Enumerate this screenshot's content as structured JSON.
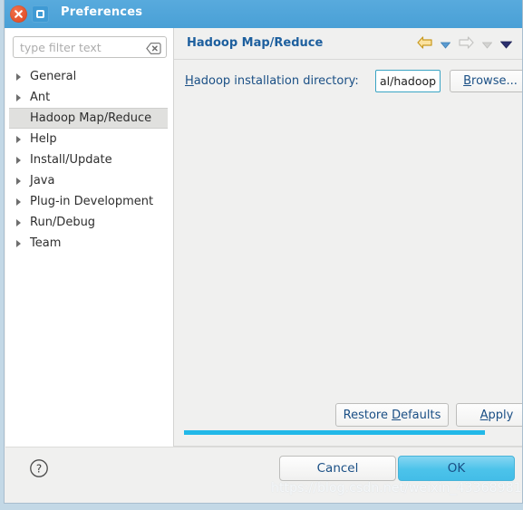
{
  "window": {
    "title": "Preferences",
    "close_icon": "close-icon",
    "maximize_icon": "maximize-icon",
    "titlebar_color": "#49a0d6"
  },
  "sidebar": {
    "filter": {
      "placeholder": "type filter text",
      "value": "",
      "clear_icon": "clear-icon"
    },
    "items": [
      {
        "label": "General",
        "expandable": true,
        "selected": false
      },
      {
        "label": "Ant",
        "expandable": true,
        "selected": false
      },
      {
        "label": "Hadoop Map/Reduce",
        "expandable": false,
        "selected": true
      },
      {
        "label": "Help",
        "expandable": true,
        "selected": false
      },
      {
        "label": "Install/Update",
        "expandable": true,
        "selected": false
      },
      {
        "label": "Java",
        "expandable": true,
        "selected": false
      },
      {
        "label": "Plug-in Development",
        "expandable": true,
        "selected": false
      },
      {
        "label": "Run/Debug",
        "expandable": true,
        "selected": false
      },
      {
        "label": "Team",
        "expandable": true,
        "selected": false
      }
    ]
  },
  "panel": {
    "title": "Hadoop Map/Reduce",
    "title_color": "#1d5f9e",
    "nav": {
      "back_icon": "back-arrow-icon",
      "back_dropdown_icon": "chevron-down-icon",
      "forward_icon": "forward-arrow-icon",
      "forward_dropdown_icon": "chevron-down-icon",
      "menu_icon": "chevron-down-icon",
      "back_enabled": true,
      "forward_enabled": false
    },
    "field": {
      "label_prefix": "H",
      "label_rest": "adoop installation directory:",
      "value": "al/hadoop",
      "focused": true,
      "focus_border_color": "#3aa4c4"
    },
    "browse_button": {
      "prefix": "B",
      "rest": "rowse..."
    },
    "restore_defaults_button": {
      "before": "Restore ",
      "mnemonic": "D",
      "after": "efaults"
    },
    "apply_button": {
      "mnemonic": "A",
      "after": "pply"
    },
    "scrollbar": {
      "orientation": "horizontal",
      "thumb_color": "#22b8e8"
    }
  },
  "footer": {
    "help_icon": "help-question-icon",
    "cancel_label": "Cancel",
    "ok_label": "OK",
    "ok_accent_color": "#4cc3ea"
  },
  "watermark": {
    "text": "https://blog.csdn.net/weixin_43368981"
  }
}
